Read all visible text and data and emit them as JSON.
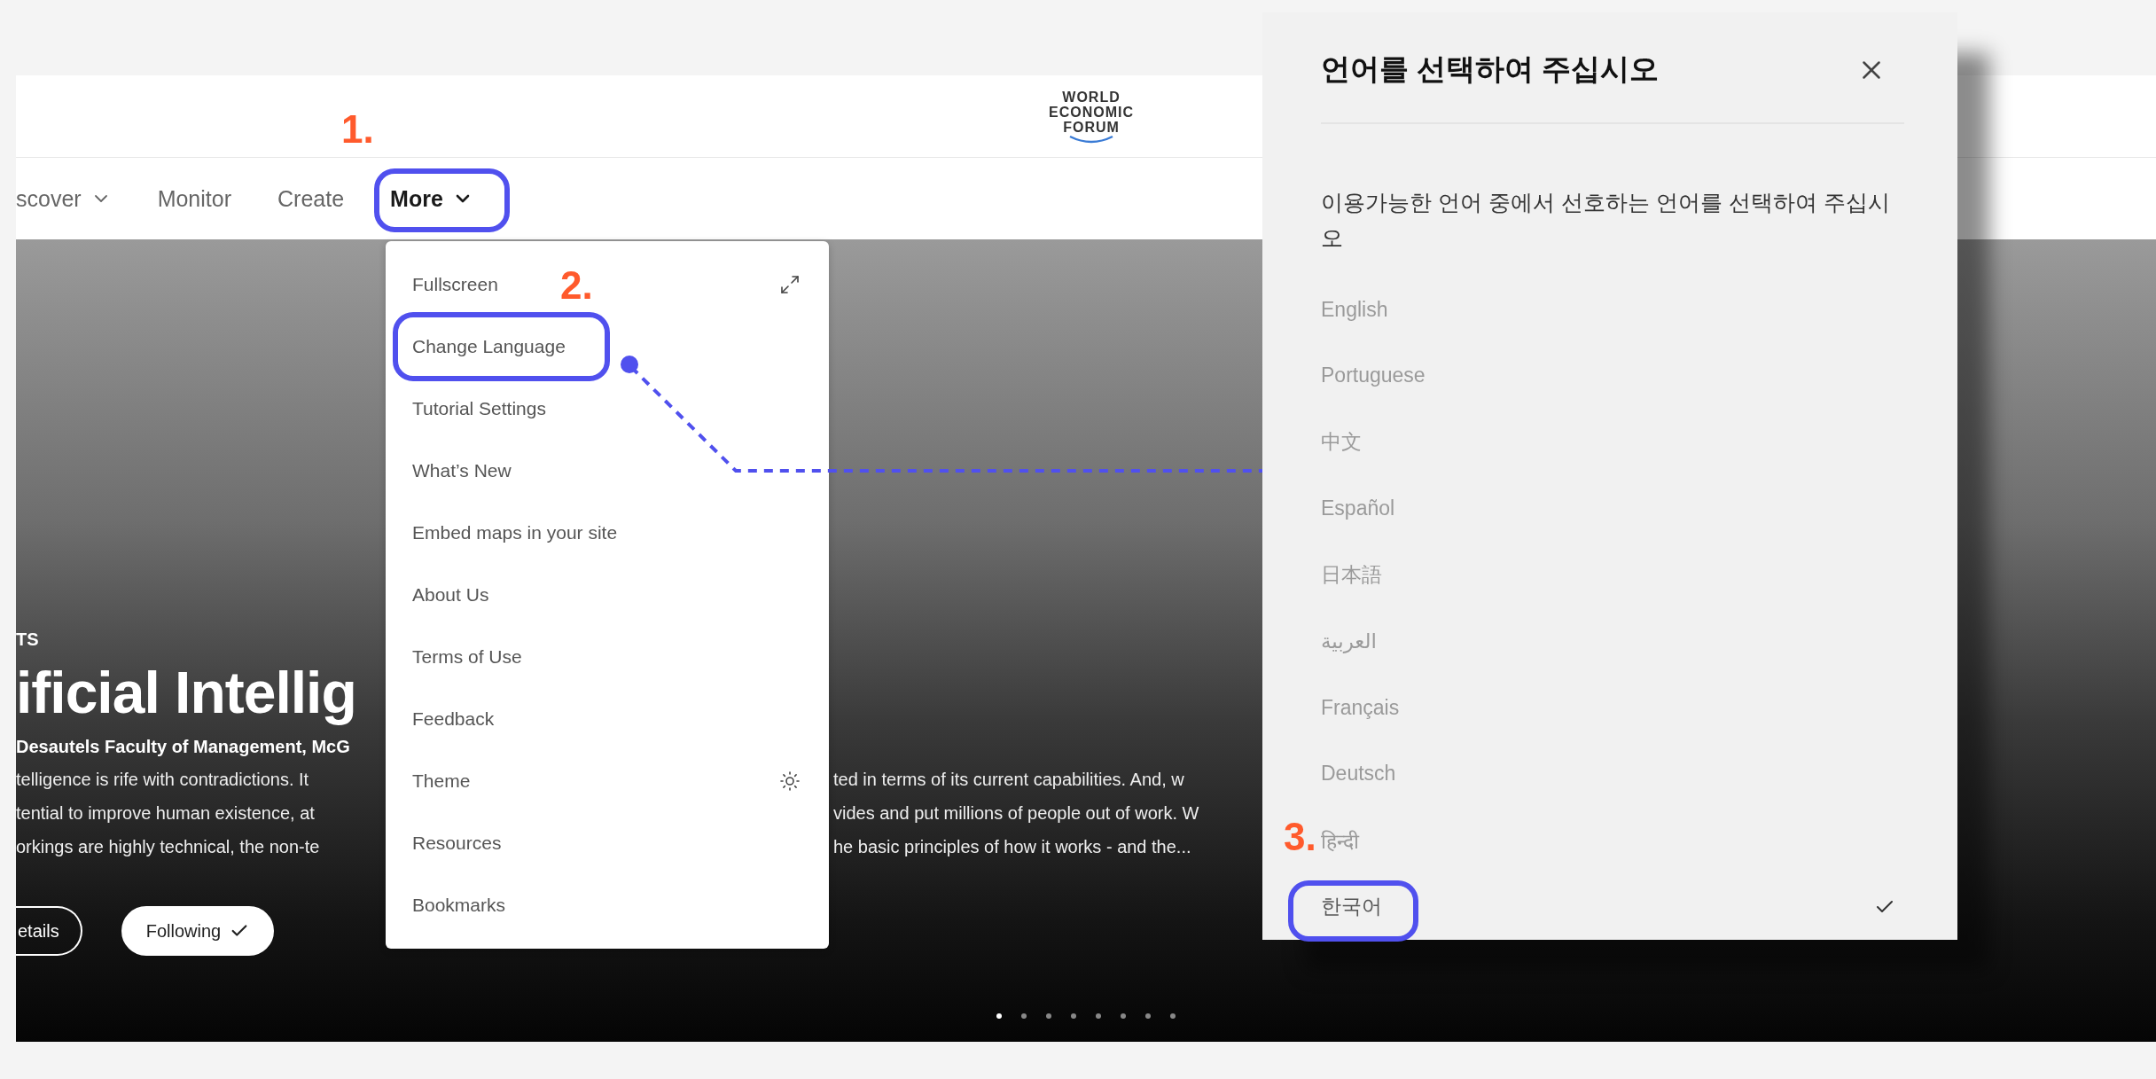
{
  "header": {
    "logo_lines": [
      "WORLD",
      "ECONOMIC",
      "FORUM"
    ]
  },
  "nav": [
    {
      "label": "scover",
      "has_caret": true,
      "selected": false
    },
    {
      "label": "Monitor",
      "has_caret": false,
      "selected": false
    },
    {
      "label": "Create",
      "has_caret": false,
      "selected": false
    },
    {
      "label": "More",
      "has_caret": true,
      "selected": true
    }
  ],
  "menu": {
    "items": [
      {
        "label": "Fullscreen"
      },
      {
        "label": "Change Language"
      },
      {
        "label": "Tutorial Settings"
      },
      {
        "label": "What’s New"
      },
      {
        "label": "Embed maps in your site"
      },
      {
        "label": "About Us"
      },
      {
        "label": "Terms of Use"
      },
      {
        "label": "Feedback"
      },
      {
        "label": "Theme"
      },
      {
        "label": "Resources"
      },
      {
        "label": "Bookmarks"
      }
    ]
  },
  "hero": {
    "tag": "TS",
    "title": "ificial Intellig",
    "subtitle": "Desautels Faculty of Management, McG",
    "description": [
      {
        "left": "telligence is rife with contradictions. It",
        "right": "ted in terms of its current capabilities. And, w"
      },
      {
        "left": "tential to improve human existence, at",
        "right": "vides and put millions of people out of work. W"
      },
      {
        "left": "orkings are highly technical, the non-te",
        "right": "he basic principles of how it works - and the..."
      }
    ],
    "buttons": [
      {
        "label": "etails",
        "kind": "outline",
        "checked": false
      },
      {
        "label": "Following",
        "kind": "filled",
        "checked": true
      }
    ],
    "dots": [
      {
        "selected": true
      },
      {
        "selected": false
      },
      {
        "selected": false
      },
      {
        "selected": false
      },
      {
        "selected": false
      },
      {
        "selected": false
      },
      {
        "selected": false
      },
      {
        "selected": false
      }
    ]
  },
  "language_dialog": {
    "title": "언어를 선택하여 주십시오",
    "description": "이용가능한 언어 중에서 선호하는 언어를 선택하여 주십시오",
    "languages": [
      {
        "label": "English",
        "selected": false
      },
      {
        "label": "Portuguese",
        "selected": false
      },
      {
        "label": "中文",
        "selected": false
      },
      {
        "label": "Español",
        "selected": false
      },
      {
        "label": "日本語",
        "selected": false
      },
      {
        "label": "العربية",
        "selected": false
      },
      {
        "label": "Français",
        "selected": false
      },
      {
        "label": "Deutsch",
        "selected": false
      },
      {
        "label": "हिन्दी",
        "selected": false
      },
      {
        "label": "한국어",
        "selected": true
      }
    ]
  },
  "annotations": [
    {
      "label": "1."
    },
    {
      "label": "2."
    },
    {
      "label": "3."
    }
  ]
}
